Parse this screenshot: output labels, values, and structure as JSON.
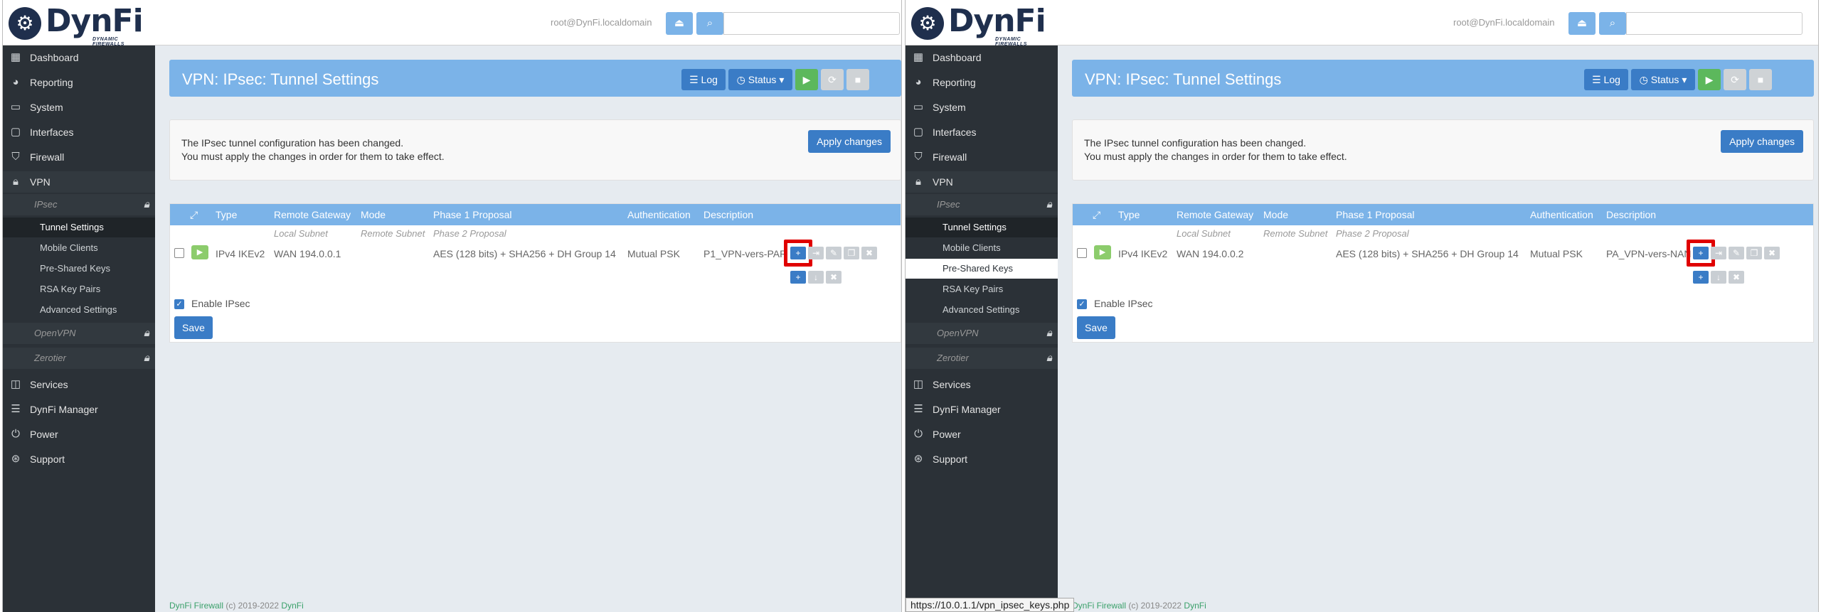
{
  "brand": {
    "name": "DynFi",
    "tagline": "DYNAMIC FIREWALLS"
  },
  "colors": {
    "accent": "#7bb3e8",
    "primary": "#3a7cc6",
    "sidebar": "#2b3137",
    "success": "#5cb85c",
    "highlight": "#e00000"
  },
  "footer": {
    "prefix": "DynFi Firewall",
    "copyright": "(c) 2019-2022",
    "link": "DynFi"
  },
  "panes": [
    {
      "user": "root@DynFi.localdomain",
      "nav": [
        {
          "label": "Dashboard",
          "icon": "dashboard-icon"
        },
        {
          "label": "Reporting",
          "icon": "pie-chart-icon"
        },
        {
          "label": "System",
          "icon": "monitor-icon"
        },
        {
          "label": "Interfaces",
          "icon": "network-icon"
        },
        {
          "label": "Firewall",
          "icon": "shield-icon"
        },
        {
          "label": "VPN",
          "icon": "lock-icon"
        }
      ],
      "vpn_sub": [
        {
          "label": "IPsec",
          "lock": true
        },
        {
          "label": "OpenVPN",
          "lock": true
        },
        {
          "label": "Zerotier",
          "lock": true
        }
      ],
      "ipsec_sub": [
        "Tunnel Settings",
        "Mobile Clients",
        "Pre-Shared Keys",
        "RSA Key Pairs",
        "Advanced Settings"
      ],
      "nav_bottom": [
        {
          "label": "Services",
          "icon": "services-icon"
        },
        {
          "label": "DynFi Manager",
          "icon": "server-icon"
        },
        {
          "label": "Power",
          "icon": "power-icon"
        },
        {
          "label": "Support",
          "icon": "support-icon"
        }
      ],
      "page_title": "VPN: IPsec: Tunnel Settings",
      "header_buttons": {
        "log": "Log",
        "status": "Status"
      },
      "alert": {
        "line1": "The IPsec tunnel configuration has been changed.",
        "line2": "You must apply the changes in order for them to take effect.",
        "apply": "Apply changes"
      },
      "table": {
        "headers": {
          "type": "Type",
          "remote_gateway": "Remote Gateway",
          "mode": "Mode",
          "phase1": "Phase 1 Proposal",
          "auth": "Authentication",
          "desc": "Description"
        },
        "subheaders": {
          "local_subnet": "Local Subnet",
          "remote_subnet": "Remote Subnet",
          "phase2": "Phase 2 Proposal"
        },
        "row": {
          "type": "IPv4 IKEv2",
          "remote_gateway": "WAN 194.0.0.1",
          "phase1": "AES (128 bits) + SHA256 + DH Group 14",
          "auth": "Mutual PSK",
          "desc": "P1_VPN-vers-PAR"
        }
      },
      "enable_label": "Enable IPsec",
      "save_label": "Save"
    },
    {
      "user": "root@DynFi.localdomain",
      "nav": [
        {
          "label": "Dashboard",
          "icon": "dashboard-icon"
        },
        {
          "label": "Reporting",
          "icon": "pie-chart-icon"
        },
        {
          "label": "System",
          "icon": "monitor-icon"
        },
        {
          "label": "Interfaces",
          "icon": "network-icon"
        },
        {
          "label": "Firewall",
          "icon": "shield-icon"
        },
        {
          "label": "VPN",
          "icon": "lock-icon"
        }
      ],
      "vpn_sub": [
        {
          "label": "IPsec",
          "lock": true
        },
        {
          "label": "OpenVPN",
          "lock": true
        },
        {
          "label": "Zerotier",
          "lock": true
        }
      ],
      "ipsec_sub": [
        "Tunnel Settings",
        "Mobile Clients",
        "Pre-Shared Keys",
        "RSA Key Pairs",
        "Advanced Settings"
      ],
      "nav_bottom": [
        {
          "label": "Services",
          "icon": "services-icon"
        },
        {
          "label": "DynFi Manager",
          "icon": "server-icon"
        },
        {
          "label": "Power",
          "icon": "power-icon"
        },
        {
          "label": "Support",
          "icon": "support-icon"
        }
      ],
      "page_title": "VPN: IPsec: Tunnel Settings",
      "header_buttons": {
        "log": "Log",
        "status": "Status"
      },
      "alert": {
        "line1": "The IPsec tunnel configuration has been changed.",
        "line2": "You must apply the changes in order for them to take effect.",
        "apply": "Apply changes"
      },
      "table": {
        "headers": {
          "type": "Type",
          "remote_gateway": "Remote Gateway",
          "mode": "Mode",
          "phase1": "Phase 1 Proposal",
          "auth": "Authentication",
          "desc": "Description"
        },
        "subheaders": {
          "local_subnet": "Local Subnet",
          "remote_subnet": "Remote Subnet",
          "phase2": "Phase 2 Proposal"
        },
        "row": {
          "type": "IPv4 IKEv2",
          "remote_gateway": "WAN 194.0.0.2",
          "phase1": "AES (128 bits) + SHA256 + DH Group 14",
          "auth": "Mutual PSK",
          "desc": "PA_VPN-vers-NAN"
        }
      },
      "enable_label": "Enable IPsec",
      "save_label": "Save",
      "status_url": "https://10.0.1.1/vpn_ipsec_keys.php"
    }
  ]
}
